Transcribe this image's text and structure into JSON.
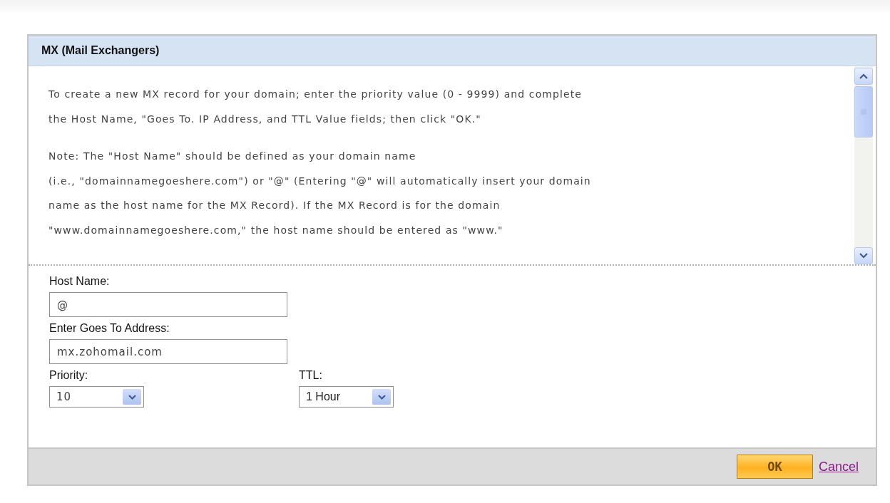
{
  "dialog": {
    "title": "MX (Mail Exchangers)",
    "instructions": [
      [
        "To create a new MX record for your domain; enter the priority value (0 - 9999) and complete",
        "the Host Name, \"Goes To. IP Address, and TTL Value fields; then click \"OK.\""
      ],
      [
        "Note: The \"Host Name\" should be defined as your domain name",
        "(i.e., \"domainnamegoeshere.com\") or \"@\" (Entering \"@\" will automatically insert your domain",
        "name as the host name for the MX Record). If the MX Record is for the domain",
        "\"www.domainnamegoeshere.com,\" the host name should be entered as \"www.\""
      ]
    ],
    "fields": [
      {
        "kind": "text",
        "label": "Host Name:",
        "value": "@"
      },
      {
        "kind": "text",
        "label": "Enter Goes To Address:",
        "value": "mx.zohomail.com"
      }
    ],
    "selects": [
      {
        "label": "Priority:",
        "value": "10"
      },
      {
        "label": "TTL:",
        "value": "1 Hour"
      }
    ],
    "buttons": [
      {
        "kind": "primary",
        "label": "OK"
      },
      {
        "kind": "link",
        "label": "Cancel"
      }
    ]
  }
}
